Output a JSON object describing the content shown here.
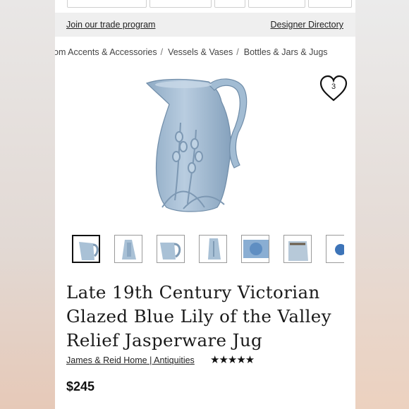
{
  "trade_bar": {
    "join_label": "Join our trade program",
    "directory_label": "Designer Directory"
  },
  "breadcrumbs": [
    "om Accents & Accessories",
    "Vessels & Vases",
    "Bottles & Jars & Jugs"
  ],
  "breadcrumb_separator": "/",
  "favorite": {
    "count": "3",
    "icon": "heart-icon"
  },
  "product": {
    "title_lines": [
      "Late 19th Century Victorian",
      "Glazed Blue Lily of the Valley",
      "Relief Jasperware Jug"
    ],
    "seller": "James & Reid Home | Antiquities",
    "rating_stars": "★★★★★",
    "rating": 5,
    "price": "$245"
  },
  "thumbnails": {
    "count_visible": 7,
    "selected_index": 0
  },
  "colors": {
    "jug": "#a9c1d6",
    "jug_shadow": "#7f9bb5",
    "thumb_accent": "#3d74b8"
  }
}
